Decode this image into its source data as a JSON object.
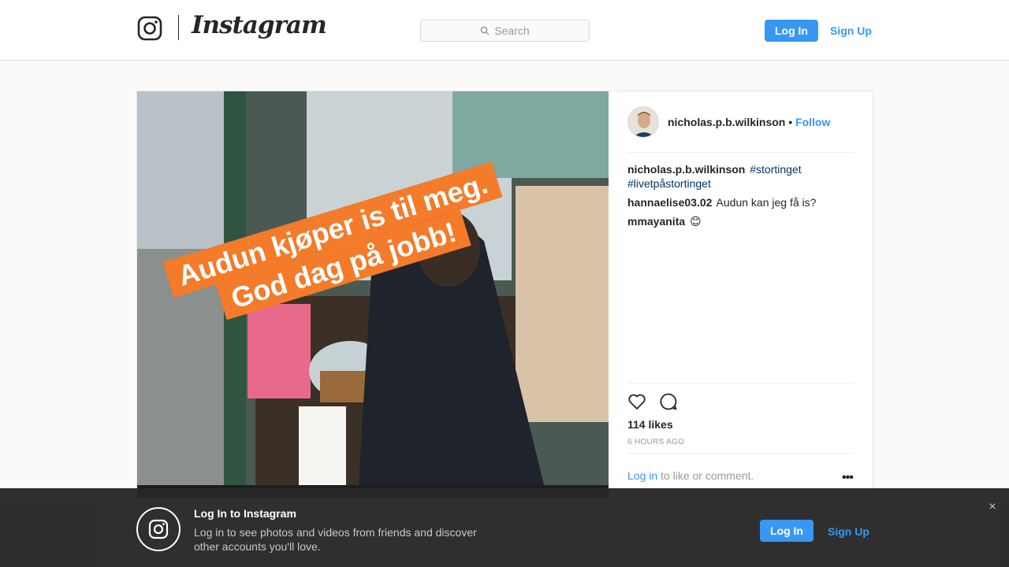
{
  "header": {
    "wordmark": "Instagram",
    "search_placeholder": "Search",
    "login_label": "Log In",
    "signup_label": "Sign Up",
    "icons": [
      "instagram-camera-icon",
      "search-icon"
    ]
  },
  "post": {
    "image_banner": [
      "Audun kjøper is til meg.",
      "God dag på jobb!"
    ],
    "author": "nicholas.p.b.wilkinson",
    "separator": "•",
    "follow_label": "Follow",
    "comments": [
      {
        "user": "nicholas.p.b.wilkinson",
        "text": "#stortinget #livetpåstortinget"
      },
      {
        "user": "hannaelise03.02",
        "text": "Audun kan jeg få is?"
      },
      {
        "user": "mmayanita",
        "text": "😊"
      }
    ],
    "likes": "114 likes",
    "timestamp": "6 HOURS AGO",
    "login_link": "Log in",
    "add_comment_text": "to like or comment.",
    "more_label": "•••",
    "icons": [
      "heart-icon",
      "comment-icon",
      "more-options-icon"
    ]
  },
  "bottom_bar": {
    "title": "Log In to Instagram",
    "text": "Log in to see photos and videos from friends and discover other accounts you'll love.",
    "login_label": "Log In",
    "signup_label": "Sign Up",
    "close_label": "×"
  },
  "colors": {
    "accent": "#3897f0",
    "hashtag": "#003569",
    "banner_orange": "#f47b2a"
  }
}
